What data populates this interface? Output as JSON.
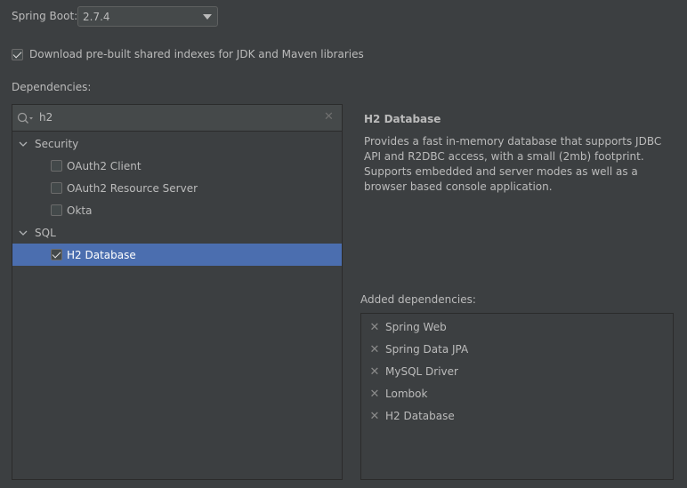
{
  "spring_boot": {
    "label": "Spring Boot:",
    "value": "2.7.4"
  },
  "shared_indexes": {
    "label": "Download pre-built shared indexes for JDK and Maven libraries",
    "checked": true
  },
  "dependencies": {
    "label": "Dependencies:",
    "search_value": "h2",
    "groups": [
      {
        "name": "Security",
        "items": [
          "OAuth2 Client",
          "OAuth2 Resource Server",
          "Okta"
        ]
      },
      {
        "name": "SQL",
        "items": [
          "H2 Database"
        ]
      }
    ]
  },
  "description": {
    "title": "H2 Database",
    "text": "Provides a fast in-memory database that supports JDBC API and R2DBC access, with a small (2mb) footprint. Supports embedded and server modes as well as a browser based console application."
  },
  "added_dependencies": {
    "label": "Added dependencies:",
    "items": [
      "Spring Web",
      "Spring Data JPA",
      "MySQL Driver",
      "Lombok",
      "H2 Database"
    ]
  }
}
